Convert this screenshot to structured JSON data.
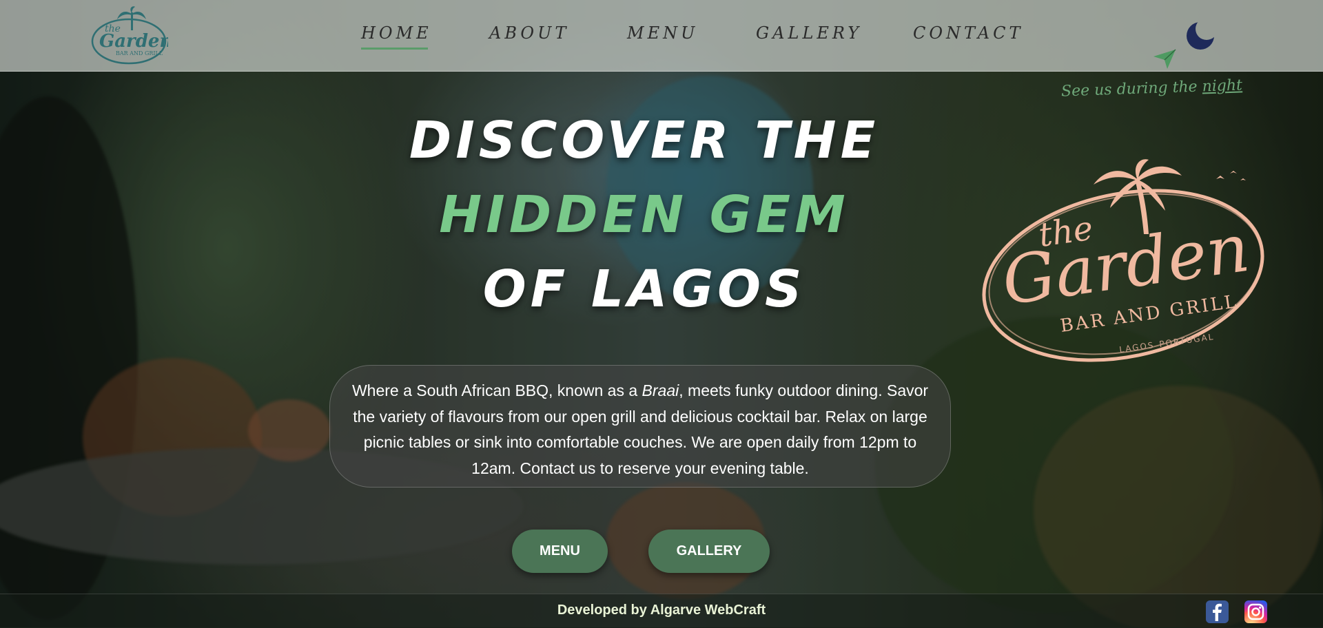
{
  "header": {
    "logo_alt": "the Garden Bar and Grill",
    "logo_lines": [
      "the",
      "Garden",
      "BAR AND GRILL"
    ],
    "nav": [
      {
        "label": "HOME",
        "active": true
      },
      {
        "label": "ABOUT",
        "active": false
      },
      {
        "label": "MENU",
        "active": false
      },
      {
        "label": "GALLERY",
        "active": false
      },
      {
        "label": "CONTACT",
        "active": false
      }
    ],
    "theme_toggle_icon": "moon-icon",
    "night_link_prefix": "See us during the ",
    "night_link_word": "night"
  },
  "hero": {
    "line1": "DISCOVER THE",
    "line2": "HIDDEN GEM",
    "line3": "OF LAGOS",
    "big_logo_lines": [
      "the",
      "Garden",
      "BAR AND GRILL",
      "LAGOS",
      "PORTUGAL"
    ],
    "description": {
      "part1": "Where a South African BBQ, known as a ",
      "italic": "Braai",
      "part2": ", meets funky outdoor dining. Savor the variety of flavours from our open grill and delicious cocktail bar. Relax on large picnic tables or sink into comfortable couches. We are open daily from 12pm to 12am. Contact us to reserve your evening table."
    },
    "buttons": {
      "menu": "MENU",
      "gallery": "GALLERY"
    }
  },
  "footer": {
    "credit": "Developed by Algarve WebCraft",
    "social": [
      "facebook-icon",
      "instagram-icon"
    ]
  },
  "colors": {
    "accent_green": "#79c98a",
    "button_green": "#4b7556",
    "logo_peach": "#f0b9a0",
    "moon_navy": "#1e2a5a"
  }
}
